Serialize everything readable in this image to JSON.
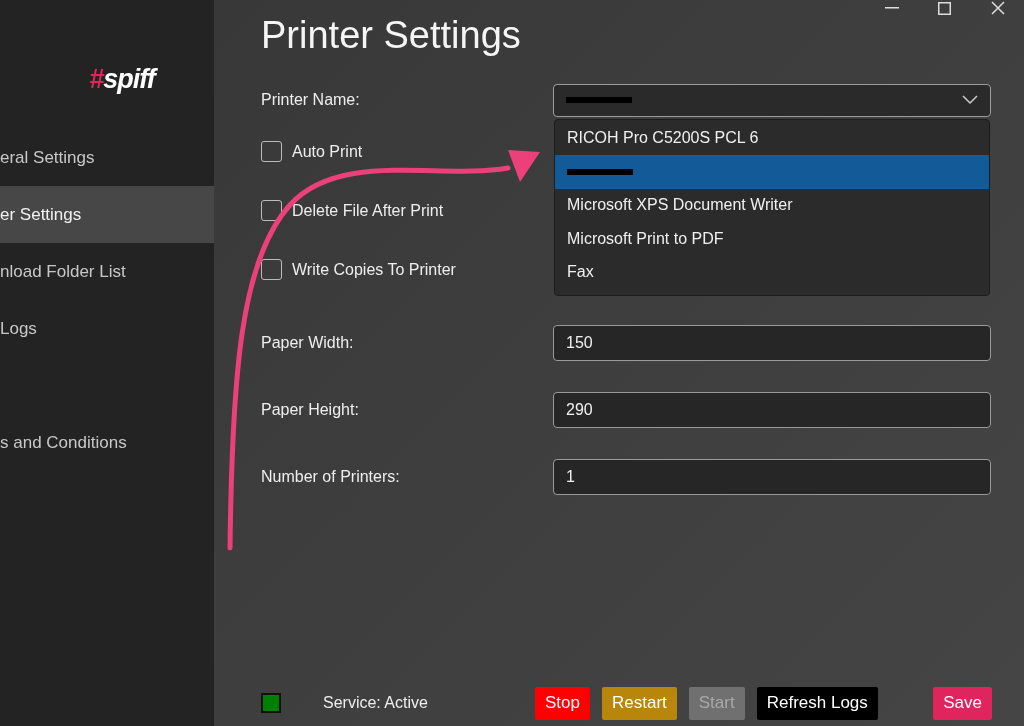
{
  "logo": {
    "hash": "#",
    "word": "spiff"
  },
  "sidebar": {
    "items": [
      {
        "label": "eral Settings",
        "selected": false
      },
      {
        "label": "er Settings",
        "selected": true
      },
      {
        "label": "nload Folder List",
        "selected": false
      },
      {
        "label": "Logs",
        "selected": false
      },
      {
        "label": "s and Conditions",
        "selected": false
      }
    ]
  },
  "page": {
    "title": "Printer Settings"
  },
  "printer_name": {
    "label": "Printer Name:",
    "value": {
      "kind": "redacted"
    },
    "expanded": true,
    "options": [
      {
        "kind": "text",
        "label": "RICOH Pro C5200S PCL 6",
        "selected": false
      },
      {
        "kind": "redacted",
        "selected": true
      },
      {
        "kind": "text",
        "label": "Microsoft XPS Document Writer",
        "selected": false
      },
      {
        "kind": "text",
        "label": "Microsoft Print to PDF",
        "selected": false
      },
      {
        "kind": "text",
        "label": "Fax",
        "selected": false
      }
    ]
  },
  "checkboxes": [
    {
      "label": "Auto Print",
      "checked": false
    },
    {
      "label": "Delete File After Print",
      "checked": false
    },
    {
      "label": "Write Copies To Printer",
      "checked": false
    }
  ],
  "fields": [
    {
      "label": "Paper Width:",
      "value": "150"
    },
    {
      "label": "Paper Height:",
      "value": "290"
    },
    {
      "label": "Number of Printers:",
      "value": "1"
    }
  ],
  "status": {
    "label": "Service: Active",
    "active": true
  },
  "buttons": [
    {
      "label": "Stop",
      "color": "#ff0000",
      "disabled": false
    },
    {
      "label": "Restart",
      "color": "#b8860b",
      "disabled": false
    },
    {
      "label": "Start",
      "color": "#707070",
      "disabled": true
    },
    {
      "label": "Refresh Logs",
      "color": "#000000",
      "disabled": false
    }
  ],
  "save_button": {
    "label": "Save",
    "color": "#e0245e"
  }
}
